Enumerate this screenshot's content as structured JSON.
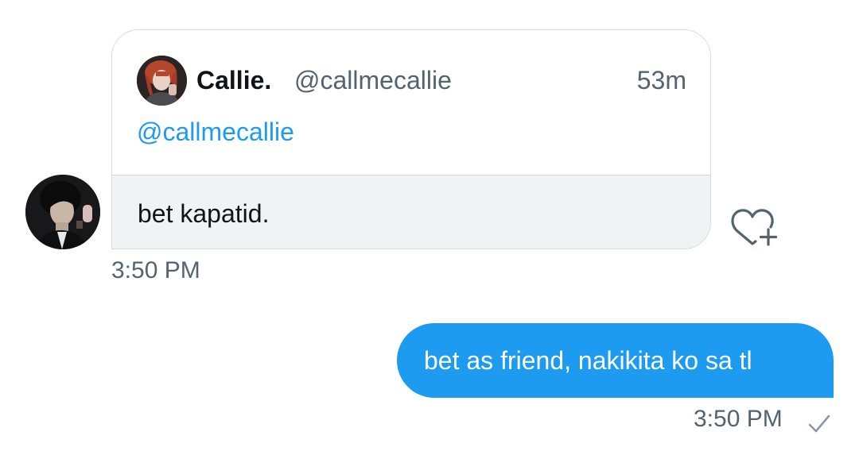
{
  "incoming": {
    "quoted": {
      "name": "Callie.",
      "handle": "@callmecallie",
      "time": "53m",
      "mention": "@callmecallie",
      "avatar_icon": "user-photo-icon"
    },
    "text": "bet kapatid.",
    "time": "3:50 PM",
    "sender_avatar_icon": "user-photo-icon",
    "react_icon": "heart-plus-icon"
  },
  "outgoing": {
    "text": "bet as friend, nakikita ko sa tl",
    "time": "3:50 PM",
    "status_icon": "checkmark-icon"
  },
  "colors": {
    "accent": "#1d9bf0",
    "secondary_text": "#536471",
    "bubble_grey": "#eff3f4",
    "border": "#d6dadd"
  }
}
